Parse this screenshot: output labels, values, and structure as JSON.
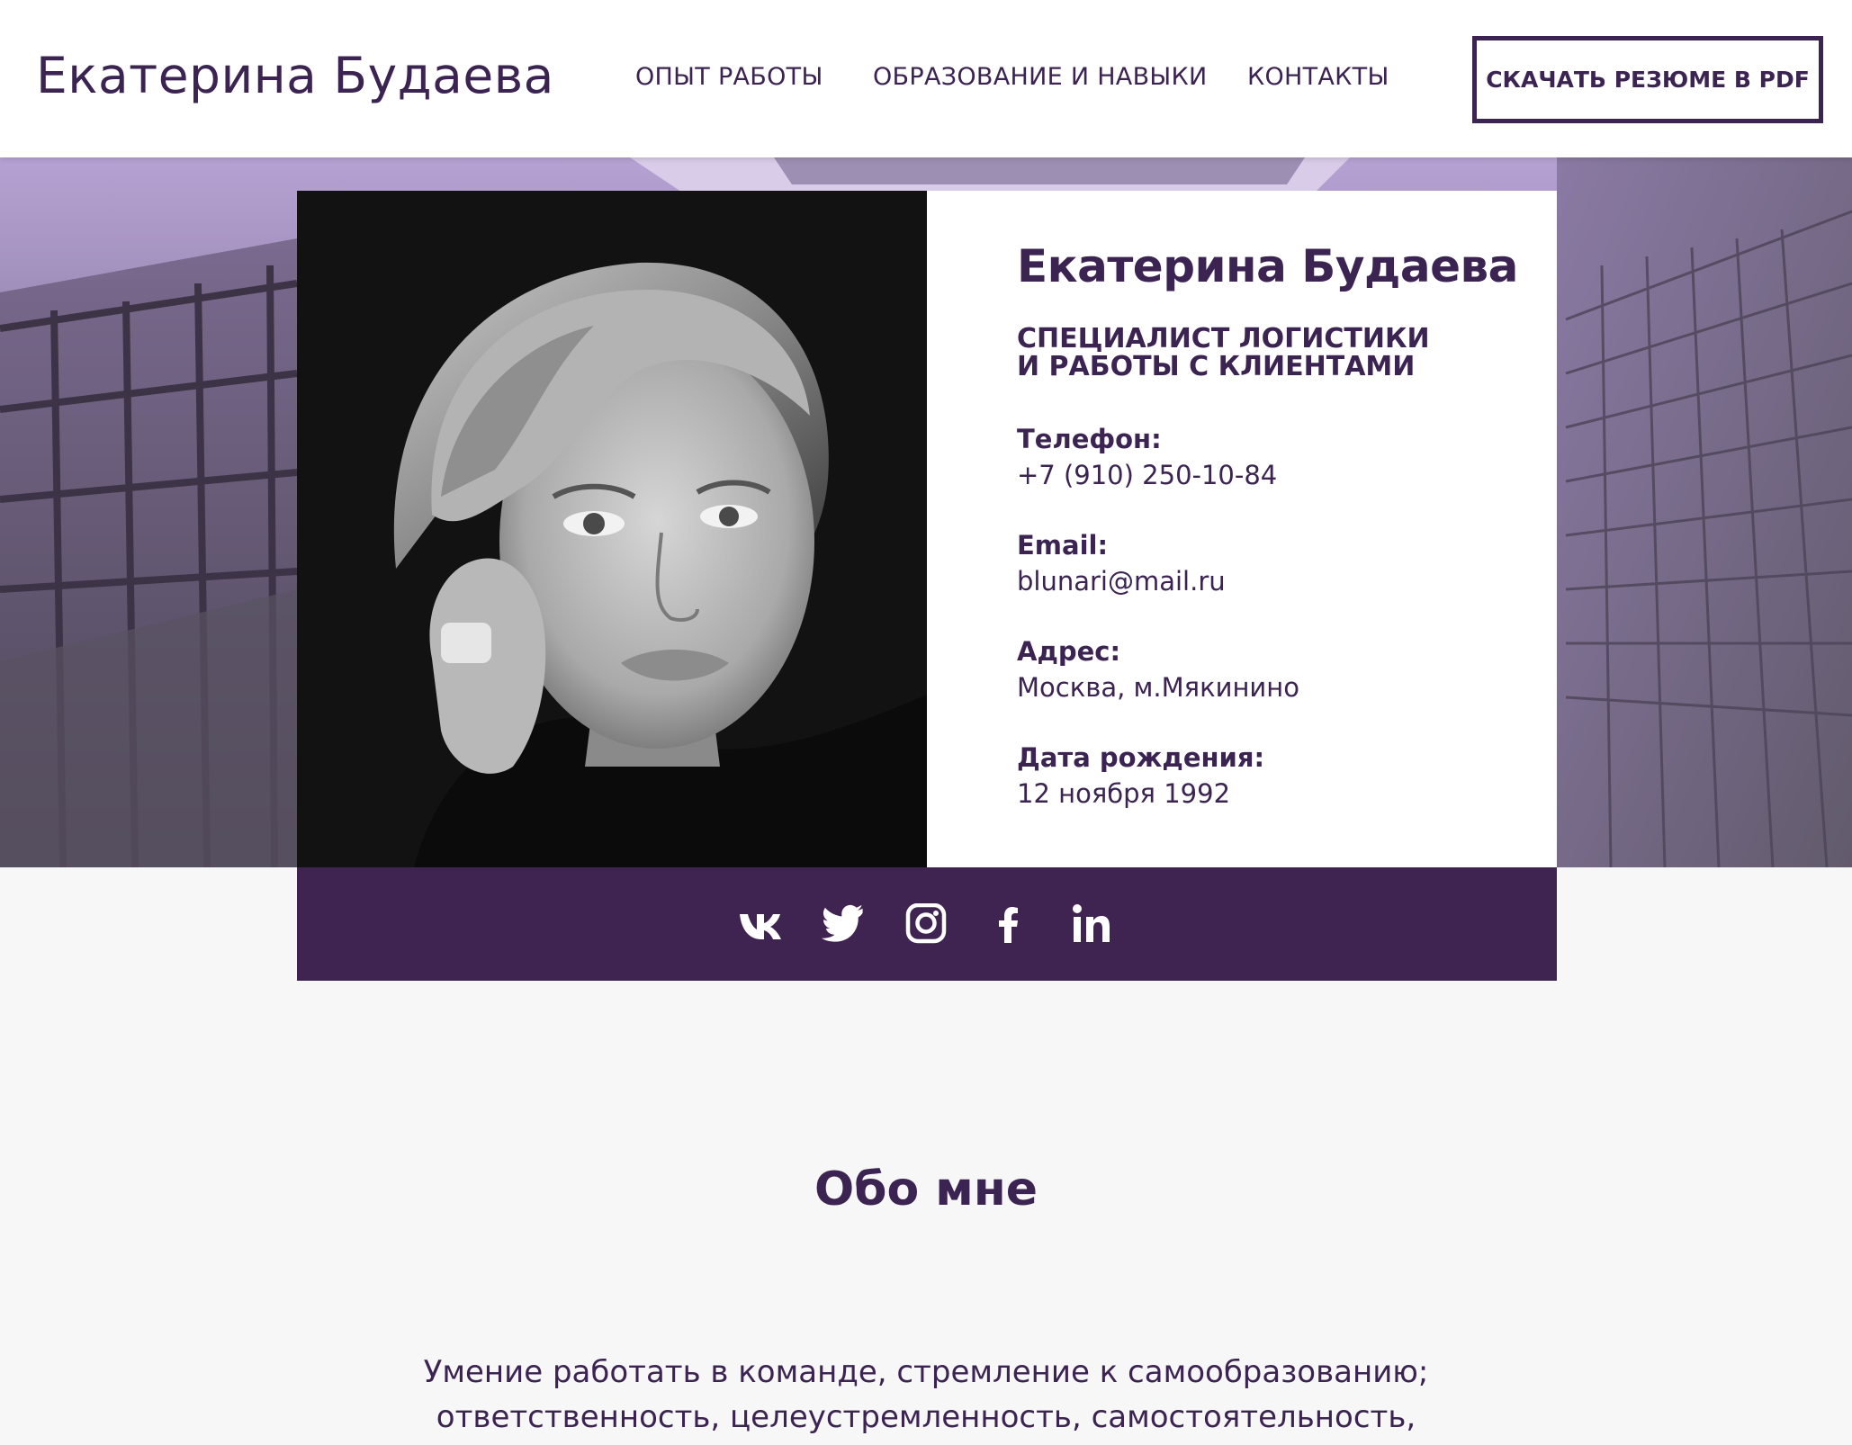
{
  "header": {
    "brand": "Екатерина Будаева",
    "nav": [
      "ОПЫТ РАБОТЫ",
      "ОБРАЗОВАНИЕ И НАВЫКИ",
      "КОНТАКТЫ"
    ],
    "pdf_button": "СКАЧАТЬ РЕЗЮМЕ В PDF"
  },
  "profile": {
    "name": "Екатерина Будаева",
    "role": "СПЕЦИАЛИСТ ЛОГИСТИКИ И РАБОТЫ С КЛИЕНТАМИ",
    "fields": [
      {
        "label": "Телефон:",
        "value": "+7 (910) 250-10-84"
      },
      {
        "label": "Email:",
        "value": "blunari@mail.ru"
      },
      {
        "label": "Адрес:",
        "value": "Москва, м.Мякинино"
      },
      {
        "label": "Дата рождения:",
        "value": "12 ноября 1992"
      }
    ]
  },
  "social": {
    "icons": [
      "vk-icon",
      "twitter-icon",
      "instagram-icon",
      "facebook-icon",
      "linkedin-icon"
    ]
  },
  "about": {
    "title": "Обо мне",
    "text_line1": "Умение работать в команде, стремление к самообразованию;",
    "text_line2": "ответственность, целеустремленность, самостоятельность,"
  },
  "colors": {
    "accent": "#3b2352",
    "social_bar": "#3f2452",
    "page_bg": "#f7f7f7"
  }
}
